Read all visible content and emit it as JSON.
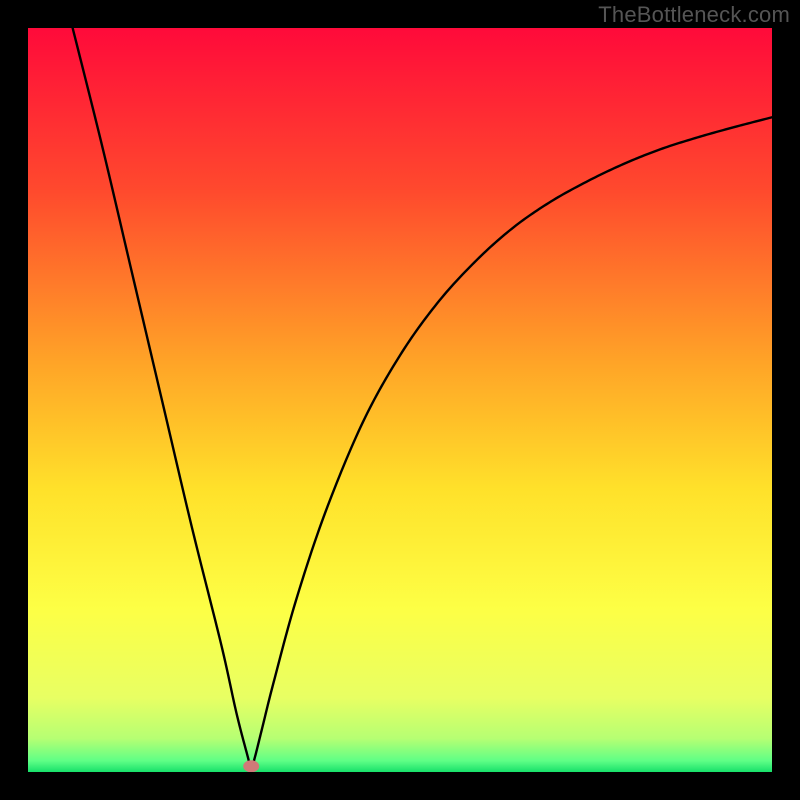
{
  "watermark": "TheBottleneck.com",
  "chart_data": {
    "type": "line",
    "title": "",
    "xlabel": "",
    "ylabel": "",
    "xlim": [
      0,
      100
    ],
    "ylim": [
      0,
      100
    ],
    "series": [
      {
        "name": "curve",
        "x": [
          6,
          10,
          14,
          18,
          22,
          26,
          28,
          29.5,
          30,
          30.5,
          31.5,
          33,
          36,
          40,
          45,
          50,
          55,
          60,
          65,
          70,
          75,
          80,
          85,
          90,
          95,
          100
        ],
        "y": [
          100,
          84,
          67,
          50,
          33,
          17,
          8,
          2.2,
          0.5,
          2,
          6,
          12,
          23,
          35,
          47,
          56,
          63,
          68.5,
          73,
          76.5,
          79.3,
          81.7,
          83.7,
          85.3,
          86.7,
          88
        ]
      }
    ],
    "marker": {
      "x": 30,
      "y": 0.5,
      "color": "#d07a78"
    },
    "gradient_stops": [
      {
        "offset": 0,
        "color": "#ff0a3a"
      },
      {
        "offset": 0.22,
        "color": "#ff4a2d"
      },
      {
        "offset": 0.45,
        "color": "#ffa427"
      },
      {
        "offset": 0.62,
        "color": "#ffe12a"
      },
      {
        "offset": 0.78,
        "color": "#fdff45"
      },
      {
        "offset": 0.9,
        "color": "#e8ff63"
      },
      {
        "offset": 0.955,
        "color": "#b6ff73"
      },
      {
        "offset": 0.985,
        "color": "#5fff86"
      },
      {
        "offset": 1.0,
        "color": "#17e06a"
      }
    ]
  }
}
